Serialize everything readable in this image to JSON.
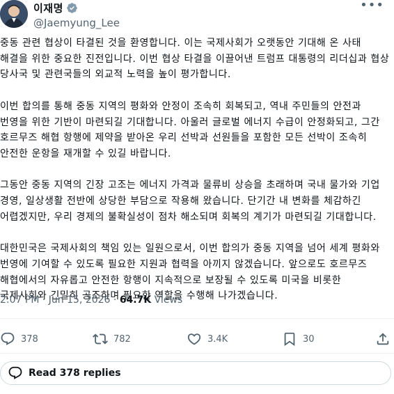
{
  "author": {
    "name": "이재명",
    "handle": "@Jaemyung_Lee",
    "verified": true
  },
  "more_icon": "more-dots-icon",
  "paragraphs": [
    "중동 관련 협상이 타결된 것을 환영합니다. 이는 국제사회가 오랫동안 기대해 온 사태 해결을 위한 중요한 진전입니다. 이번 협상 타결을 이끌어낸 트럼프 대통령의 리더십과 협상 당사국 및 관련국들의 외교적 노력을 높이 평가합니다.",
    "이번 합의를 통해 중동 지역의 평화와 안정이 조속히 회복되고, 역내 주민들의 안전과 번영을 위한 기반이 마련되길 기대합니다. 아울러 글로벌 에너지 수급이 안정화되고, 그간 호르무즈 해협 항행에 제약을 받아온 우리 선박과 선원들을 포함한 모든 선박이 조속히 안전한 운항을 재개할 수 있길 바랍니다.",
    "그동안 중동 지역의 긴장 고조는 에너지 가격과 물류비 상승을 초래하며 국내 물가와 기업 경영, 일상생활 전반에 상당한 부담으로 작용해 왔습니다. 단기간 내 변화를 체감하긴 어렵겠지만, 우리 경제의 불확실성이 점차 해소되며 회복의 계기가 마련되길 기대합니다.",
    "대한민국은 국제사회의 책임 있는 일원으로서, 이번 합의가 중동 지역을 넘어 세계 평화와 번영에 기여할 수 있도록 필요한 지원과 협력을 아끼지 않겠습니다. 앞으로도 호르무즈 해협에서의 자유롭고 안전한 항행이 지속적으로 보장될 수 있도록 미국을 비롯한 국제사회와 긴밀히 공조하며 필요한 역할을 수행해 나가겠습니다."
  ],
  "meta": {
    "time": "2:07 PM",
    "sep": " · ",
    "date": "Jun 15, 2026",
    "views_count": "64.7K",
    "views_label": " Views"
  },
  "actions": {
    "replies": "378",
    "reposts": "782",
    "likes": "3.4K",
    "bookmarks": "30"
  },
  "read_replies": "Read 378 replies",
  "colors": {
    "text": "#0f1419",
    "secondary": "#536471",
    "verified": "#829aab",
    "divider": "#eff3f4"
  }
}
